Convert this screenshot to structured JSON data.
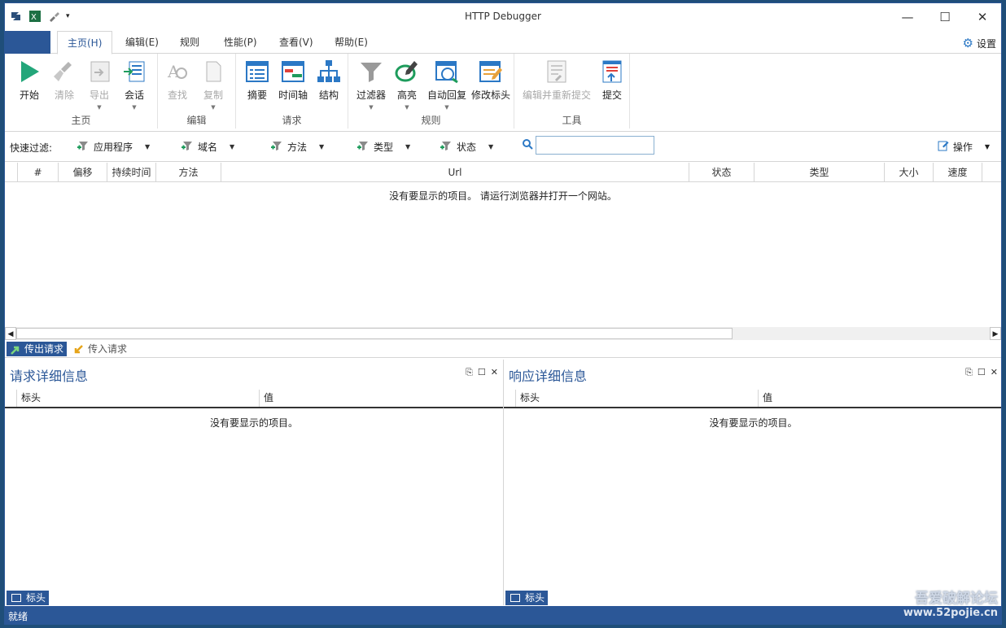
{
  "window": {
    "title": "HTTP Debugger"
  },
  "ribbon_tabs": [
    "主页(H)",
    "编辑(E)",
    "规则",
    "性能(P)",
    "查看(V)",
    "帮助(E)"
  ],
  "settings_label": "设置",
  "groups": {
    "home": {
      "label": "主页",
      "start": "开始",
      "clear": "清除",
      "export": "导出",
      "session": "会话"
    },
    "edit": {
      "label": "编辑",
      "find": "查找",
      "copy": "复制"
    },
    "request": {
      "label": "请求",
      "summary": "摘要",
      "timeline": "时间轴",
      "structure": "结构"
    },
    "rules": {
      "label": "规则",
      "filter": "过滤器",
      "highlight": "高亮",
      "autoreply": "自动回复",
      "modifyheader": "修改标头"
    },
    "tools": {
      "label": "工具",
      "editresubmit": "编辑并重新提交",
      "submit": "提交"
    }
  },
  "quick_filter": {
    "label": "快速过滤:",
    "items": [
      "应用程序",
      "域名",
      "方法",
      "类型",
      "状态"
    ],
    "search_value": "",
    "ops_label": "操作"
  },
  "grid": {
    "columns": [
      "#",
      "偏移",
      "持续时间",
      "方法",
      "Url",
      "状态",
      "类型",
      "大小",
      "速度"
    ],
    "empty_message": "没有要显示的项目。 请运行浏览器并打开一个网站。"
  },
  "req_tabs": {
    "outgoing": "传出请求",
    "incoming": "传入请求"
  },
  "left_panel": {
    "title": "请求详细信息",
    "col_header": "标头",
    "col_value": "值",
    "empty": "没有要显示的项目。",
    "footer_tab": "标头"
  },
  "right_panel": {
    "title": "响应详细信息",
    "col_header": "标头",
    "col_value": "值",
    "empty": "没有要显示的项目。",
    "footer_tab": "标头"
  },
  "status": {
    "text": "就绪"
  },
  "watermark": {
    "line1": "吾爱破解论坛",
    "line2": "www.52pojie.cn"
  },
  "colors": {
    "accent": "#2b5797",
    "start_green": "#23a67a"
  }
}
